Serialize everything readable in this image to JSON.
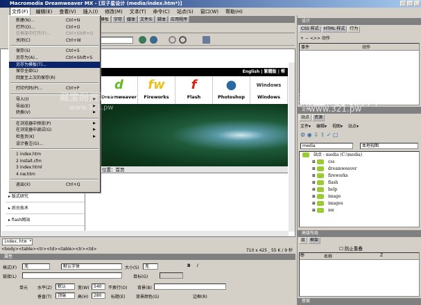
{
  "window": {
    "title": "Macromedia Dreamweaver MX - [双子星设计 (media/index.htm*)]"
  },
  "menubar": [
    "文件(F)",
    "编辑(E)",
    "查看(V)",
    "插入(I)",
    "修改(M)",
    "文本(T)",
    "命令(C)",
    "站点(S)",
    "窗口(W)",
    "帮助(H)"
  ],
  "insert_tabs": [
    "模板",
    "字符",
    "媒体",
    "文件头",
    "脚本",
    "应用程序"
  ],
  "file_menu": [
    {
      "label": "新建(N)...",
      "shortcut": "Ctrl+N"
    },
    {
      "label": "打开(O)...",
      "shortcut": "Ctrl+O"
    },
    {
      "label": "在框架中打开(F)...",
      "shortcut": "Ctrl+Shift+O",
      "disabled": true
    },
    {
      "label": "关闭(C)",
      "shortcut": "Ctrl+W"
    },
    {
      "sep": true
    },
    {
      "label": "保存(S)",
      "shortcut": "Ctrl+S"
    },
    {
      "label": "另存为(A)...",
      "shortcut": "Ctrl+Shift+S"
    },
    {
      "label": "另存为模板(T)...",
      "highlighted": true
    },
    {
      "label": "保存全部(L)"
    },
    {
      "label": "回复至上次的保存(R)"
    },
    {
      "sep": true
    },
    {
      "label": "打印代码(P)...",
      "shortcut": "Ctrl+P"
    },
    {
      "sep": true
    },
    {
      "label": "导入(I)",
      "submenu": true
    },
    {
      "label": "导出(E)",
      "submenu": true
    },
    {
      "label": "转换(V)",
      "submenu": true
    },
    {
      "sep": true
    },
    {
      "label": "在浏览器中预览(P)",
      "submenu": true
    },
    {
      "label": "在浏览器中调试(G)",
      "submenu": true
    },
    {
      "label": "检查页(K)",
      "submenu": true
    },
    {
      "label": "设计备注(G)..."
    },
    {
      "sep": true
    },
    {
      "label": "1 index.htm"
    },
    {
      "label": "2 install.cfm"
    },
    {
      "label": "3 index.html"
    },
    {
      "label": "4 nw.htm"
    },
    {
      "sep": true
    },
    {
      "label": "退出(X)",
      "shortcut": "Ctrl+Q"
    }
  ],
  "page": {
    "topbar": "English | 繁體版 | 帮",
    "apps": [
      {
        "label": "Dreamweaver",
        "icon": "d",
        "color": "#66bb22"
      },
      {
        "label": "Fireworks",
        "icon": "fw",
        "color": "#e8c020"
      },
      {
        "label": "Flash",
        "icon": "f",
        "color": "#e02010"
      },
      {
        "label": "Photoshop",
        "icon": "●",
        "color": "#2a6aa0"
      },
      {
        "label": "Windows",
        "icon": "Windows",
        "color": "#333"
      }
    ],
    "breadcrumb": "位置：首页",
    "nav": [
      "版式研究",
      "后台技术",
      "flash网站"
    ]
  },
  "doc_tab": "index.htm *",
  "status": {
    "tags": "<body><table><tr><td><table><tr><td>",
    "size": "710 x 425 ‸ 55 K / 9 秒"
  },
  "properties": {
    "title": "属性",
    "format_label": "格式(F)",
    "format_value": "无",
    "font_value": "默认字体",
    "size_label": "大小(S)",
    "size_value": "无",
    "link_label": "链接(L)",
    "target_label": "目标(G)",
    "cell_label": "单元",
    "horz_label": "水平(Z)",
    "horz_value": "默认",
    "width_label": "宽(W)",
    "width_value": "540",
    "nowrap_label": "不换行(O)",
    "bg_label": "背景(B)",
    "vert_label": "垂直(T)",
    "vert_value": "顶端",
    "height_label": "高(H)",
    "height_value": "280",
    "header_label": "标题(E)",
    "bgcolor_label": "背景颜色(G)",
    "border_label": "边框(R)"
  },
  "design_panel": {
    "title": "设计",
    "tabs": [
      "CSS 样式",
      "HTML 样式",
      "行为"
    ],
    "active_tab": "行为",
    "actions_label": "<>> 动作",
    "columns": [
      "事件",
      "动作"
    ]
  },
  "site_panel": {
    "title": "文件",
    "tabs": [
      "站点",
      "资源"
    ],
    "menus": [
      "文件▾",
      "编辑▾",
      "视图▾",
      "站点▾"
    ],
    "site_select": "media",
    "view_select": "本地视图",
    "root": "站点 - media (C:\\media)",
    "folders": [
      "css",
      "dreamweaver",
      "fireworks",
      "flash",
      "help",
      "image",
      "images",
      "nw"
    ]
  },
  "layers_panel": {
    "title": "高级布局",
    "tabs": [
      "层",
      "框架"
    ],
    "prevent_overlap": "防止重叠",
    "columns": [
      "",
      "名称",
      "Z"
    ]
  },
  "answers_panel": {
    "title": "答案"
  },
  "watermark": {
    "cn": "藏宝阁资源库",
    "url": "www.321.pw"
  }
}
